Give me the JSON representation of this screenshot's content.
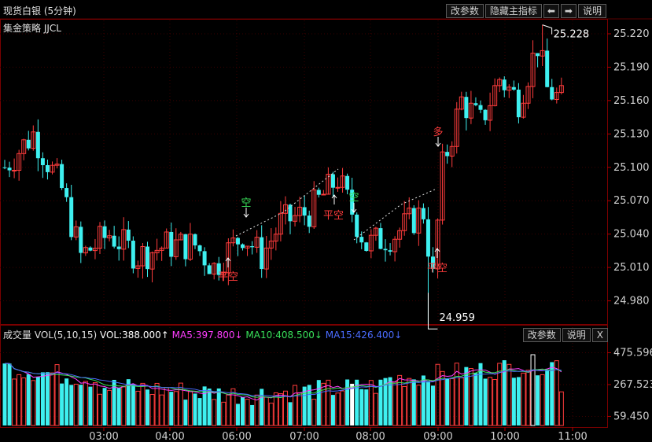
{
  "header": {
    "title": "现货白银 (5分钟)",
    "strategy": "集金策略 JJCL",
    "buttons": [
      "改参数",
      "隐藏主指标",
      "⬅",
      "➡",
      "说明"
    ]
  },
  "volume_header": {
    "label": "成交量",
    "params": "VOL(5,10,15)",
    "vol": "VOL:388.000↑",
    "ma5": "MA5:397.800↓",
    "ma10": "MA10:408.500↓",
    "ma15": "MA15:426.400↓",
    "buttons": [
      "改参数",
      "说明",
      "X"
    ]
  },
  "annotations": {
    "high_label": "25.228",
    "low_label": "24.959",
    "signal_kong": "空",
    "signal_duo": "多",
    "signal_pingkong": "平空"
  },
  "colors": {
    "up": "#ff3c3c",
    "down": "#3ef0f0",
    "background": "#000000",
    "grid": "#3a0000",
    "axis_text": "#d0d0d0",
    "ma5": "#ff3dff",
    "ma10": "#38e05a",
    "ma15": "#4a6cff"
  },
  "chart_data": [
    {
      "type": "candlestick",
      "title": "现货白银 (5分钟)",
      "y_ticks": [
        "25.220",
        "25.190",
        "25.160",
        "25.130",
        "25.100",
        "25.070",
        "25.040",
        "25.010",
        "24.980"
      ],
      "ylim": [
        24.962,
        25.232
      ],
      "x_ticks": [
        "03:00",
        "04:00",
        "06:00",
        "07:00",
        "08:00",
        "09:00",
        "10:00",
        "11:00"
      ],
      "high": 25.228,
      "low": 24.959
    },
    {
      "type": "bar",
      "title": "成交量 VOL(5,10,15)",
      "y_ticks": [
        "475.596",
        "267.523",
        "59.450"
      ],
      "ylim": [
        0,
        540
      ],
      "last_values": {
        "VOL": 388.0,
        "MA5": 397.8,
        "MA10": 408.5,
        "MA15": 426.4
      }
    }
  ]
}
